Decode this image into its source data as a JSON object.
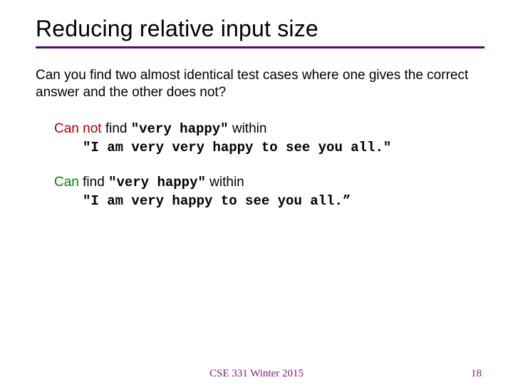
{
  "title": "Reducing relative input size",
  "question": "Can you find two almost identical test cases where one gives the correct answer and the other does not?",
  "ex1": {
    "cannot": "Can not",
    "find": " find ",
    "code1": "\"very happy\"",
    "within": " within",
    "code2": "\"I am very very happy to see you all.\""
  },
  "ex2": {
    "can": "Can",
    "find": " find ",
    "code1": "\"very happy\"",
    "within": " within",
    "code2": "\"I am very happy to see you all.”"
  },
  "footer": {
    "course": "CSE 331 Winter 2015",
    "page": "18"
  }
}
